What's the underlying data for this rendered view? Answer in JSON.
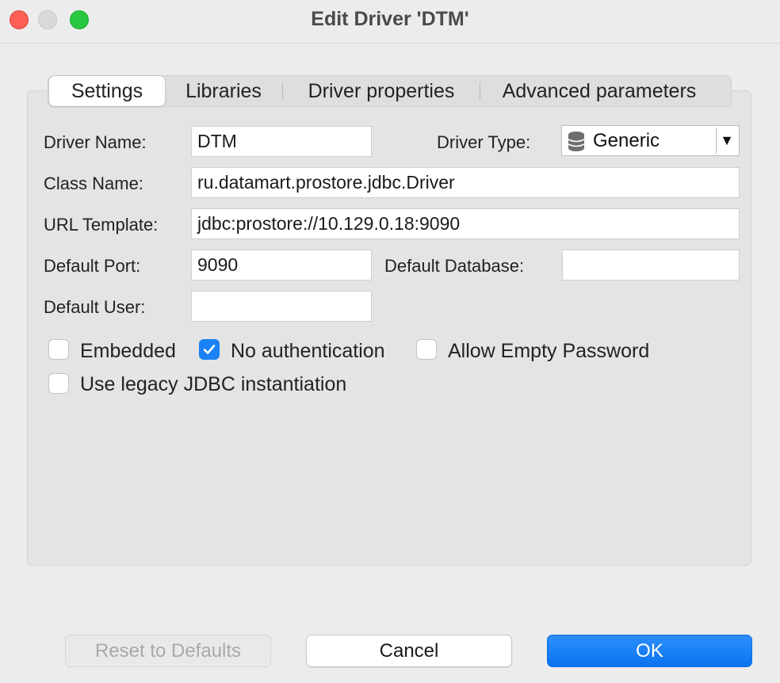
{
  "window": {
    "title": "Edit Driver 'DTM'"
  },
  "tabs": [
    {
      "label": "Settings",
      "active": true
    },
    {
      "label": "Libraries",
      "active": false
    },
    {
      "label": "Driver properties",
      "active": false
    },
    {
      "label": "Advanced parameters",
      "active": false
    }
  ],
  "form": {
    "driver_name": {
      "label": "Driver Name:",
      "value": "DTM"
    },
    "driver_type": {
      "label": "Driver Type:",
      "value": "Generic",
      "icon": "database-icon"
    },
    "class_name": {
      "label": "Class Name:",
      "value": "ru.datamart.prostore.jdbc.Driver"
    },
    "url_template": {
      "label": "URL Template:",
      "value": "jdbc:prostore://10.129.0.18:9090"
    },
    "default_port": {
      "label": "Default Port:",
      "value": "9090"
    },
    "default_database": {
      "label": "Default Database:",
      "value": ""
    },
    "default_user": {
      "label": "Default User:",
      "value": ""
    }
  },
  "checkboxes": {
    "embedded": {
      "label": "Embedded",
      "checked": false
    },
    "no_authentication": {
      "label": "No authentication",
      "checked": true
    },
    "allow_empty_password": {
      "label": "Allow Empty Password",
      "checked": false
    },
    "use_legacy_jdbc": {
      "label": "Use legacy JDBC instantiation",
      "checked": false
    }
  },
  "buttons": {
    "reset": "Reset to Defaults",
    "cancel": "Cancel",
    "ok": "OK"
  },
  "colors": {
    "accent": "#1a82f6",
    "close": "#fe5f57",
    "minimize": "#d9d9d9",
    "maximize": "#28c840"
  }
}
